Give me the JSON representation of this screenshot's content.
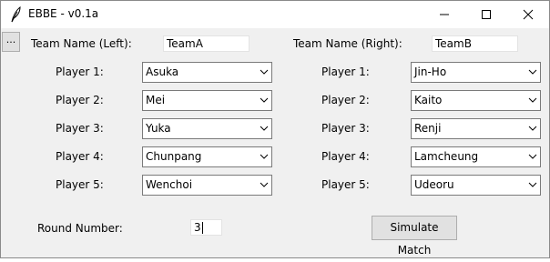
{
  "window": {
    "title": "EBBE - v0.1a"
  },
  "toolbar": {
    "menu_label": "..."
  },
  "left": {
    "team_label": "Team Name (Left):",
    "team_value": "TeamA",
    "players": [
      {
        "label": "Player 1:",
        "value": "Asuka"
      },
      {
        "label": "Player 2:",
        "value": "Mei"
      },
      {
        "label": "Player 3:",
        "value": "Yuka"
      },
      {
        "label": "Player 4:",
        "value": "Chunpang"
      },
      {
        "label": "Player 5:",
        "value": "Wenchoi"
      }
    ]
  },
  "right": {
    "team_label": "Team Name (Right):",
    "team_value": "TeamB",
    "players": [
      {
        "label": "Player 1:",
        "value": "Jin-Ho"
      },
      {
        "label": "Player 2:",
        "value": "Kaito"
      },
      {
        "label": "Player 3:",
        "value": "Renji"
      },
      {
        "label": "Player 4:",
        "value": "Lamcheung"
      },
      {
        "label": "Player 5:",
        "value": "Udeoru"
      }
    ]
  },
  "round": {
    "label": "Round Number:",
    "value": "3"
  },
  "actions": {
    "simulate_label": "Simulate Match"
  },
  "icons": {
    "app": "feather-icon",
    "minimize": "minimize-icon",
    "maximize": "maximize-icon",
    "close": "close-icon",
    "dropdown": "chevron-down-icon"
  }
}
